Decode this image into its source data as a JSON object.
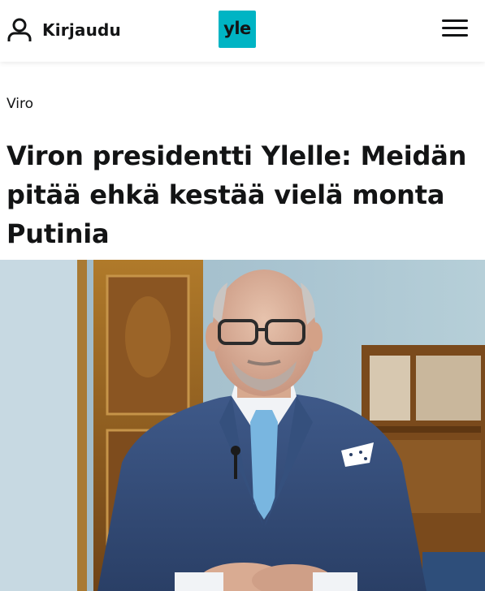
{
  "header": {
    "login_label": "Kirjaudu",
    "logo_text": "yle",
    "logo_color": "#00b4c4",
    "icons": [
      "user-icon",
      "hamburger-menu-icon"
    ]
  },
  "article": {
    "category": "Viro",
    "headline": "Viron presidentti Ylelle: Meidän pitää ehkä kestää vielä monta Putinia"
  }
}
